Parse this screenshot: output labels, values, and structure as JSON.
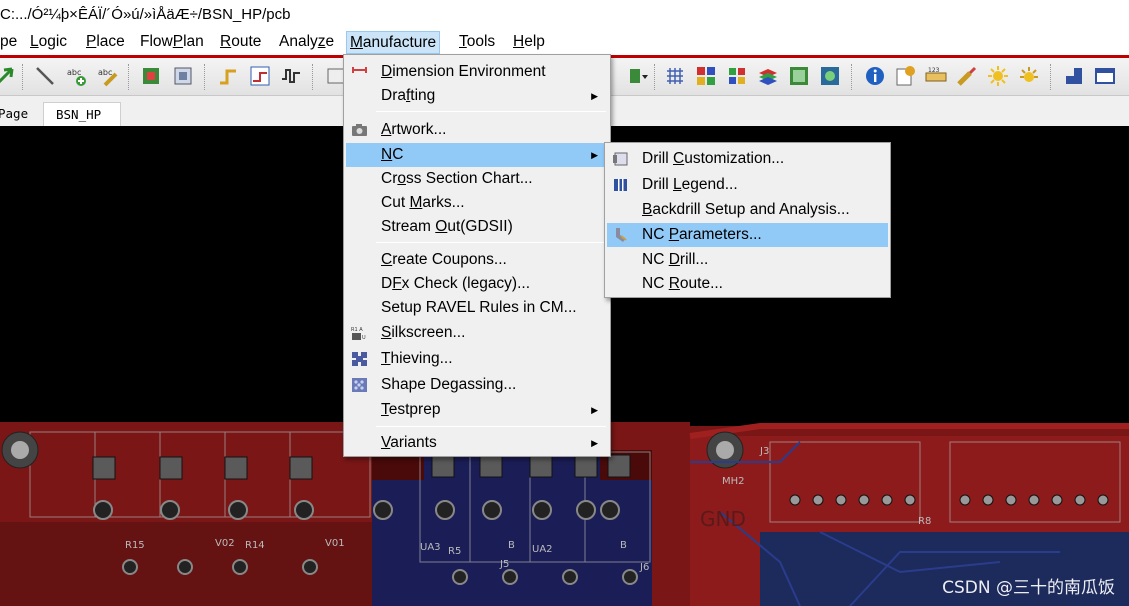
{
  "title": "C:.../Ó²¼þ×ÊÁÏ/´Ó»ú/»ìÅäÆ÷/BSN_HP/pcb",
  "menubar": {
    "items": [
      {
        "pre": "",
        "acc": "",
        "post": "pe"
      },
      {
        "pre": "",
        "acc": "L",
        "post": "ogic"
      },
      {
        "pre": "",
        "acc": "P",
        "post": "lace"
      },
      {
        "pre": "Flow",
        "acc": "P",
        "post": "lan"
      },
      {
        "pre": "",
        "acc": "R",
        "post": "oute"
      },
      {
        "pre": "Analy",
        "acc": "z",
        "post": "e"
      },
      {
        "pre": "",
        "acc": "M",
        "post": "anufacture"
      },
      {
        "pre": "",
        "acc": "T",
        "post": "ools"
      },
      {
        "pre": "",
        "acc": "H",
        "post": "elp"
      }
    ]
  },
  "tabs": [
    "Page",
    "BSN_HP"
  ],
  "manufacture_menu": {
    "items": [
      {
        "pre": "",
        "acc": "D",
        "post": "imension Environment",
        "icon": "dimension-icon",
        "submenu": false
      },
      {
        "pre": "Dra",
        "acc": "f",
        "post": "ting",
        "icon": "",
        "submenu": true
      },
      {
        "pre": "",
        "acc": "A",
        "post": "rtwork...",
        "icon": "camera-icon",
        "submenu": false
      },
      {
        "pre": "",
        "acc": "N",
        "post": "C",
        "icon": "",
        "submenu": true
      },
      {
        "pre": "Cr",
        "acc": "o",
        "post": "ss Section Chart...",
        "icon": "",
        "submenu": false
      },
      {
        "pre": "Cut ",
        "acc": "M",
        "post": "arks...",
        "icon": "",
        "submenu": false
      },
      {
        "pre": "Stream ",
        "acc": "O",
        "post": "ut(GDSII)",
        "icon": "",
        "submenu": false
      },
      {
        "pre": "",
        "acc": "C",
        "post": "reate Coupons...",
        "icon": "",
        "submenu": false
      },
      {
        "pre": "D",
        "acc": "F",
        "post": "x Check (legacy)...",
        "icon": "",
        "submenu": false
      },
      {
        "pre": "Setup RAVEL Rules in CM...",
        "acc": "",
        "post": "",
        "icon": "",
        "submenu": false
      },
      {
        "pre": "",
        "acc": "S",
        "post": "ilkscreen...",
        "icon": "silkscreen-icon",
        "submenu": false
      },
      {
        "pre": "",
        "acc": "T",
        "post": "hieving...",
        "icon": "thieving-icon",
        "submenu": false
      },
      {
        "pre": "Shape De",
        "acc": "g",
        "post": "assing...",
        "icon": "degassing-icon",
        "submenu": false
      },
      {
        "pre": "",
        "acc": "T",
        "post": "estprep",
        "icon": "",
        "submenu": true
      },
      {
        "pre": "",
        "acc": "V",
        "post": "ariants",
        "icon": "",
        "submenu": true
      }
    ]
  },
  "nc_submenu": {
    "items": [
      {
        "pre": "Drill ",
        "acc": "C",
        "post": "ustomization...",
        "icon": "drill-customization-icon"
      },
      {
        "pre": "Drill ",
        "acc": "L",
        "post": "egend...",
        "icon": "drill-legend-icon"
      },
      {
        "pre": "",
        "acc": "B",
        "post": "ackdrill Setup and Analysis...",
        "icon": ""
      },
      {
        "pre": "NC ",
        "acc": "P",
        "post": "arameters...",
        "icon": "nc-parameters-icon"
      },
      {
        "pre": "NC ",
        "acc": "D",
        "post": "rill...",
        "icon": ""
      },
      {
        "pre": "NC ",
        "acc": "R",
        "post": "oute...",
        "icon": ""
      }
    ]
  },
  "pcb_labels": {
    "gnd": "GND",
    "j3": "J3",
    "mh2": "MH2",
    "r15": "R15",
    "v02": "V02",
    "v01": "V01",
    "r14": "R14",
    "ua3": "UA3",
    "r5": "R5",
    "ua2": "UA2",
    "b1": "B",
    "b2": "B",
    "j5": "J5",
    "j6": "J6",
    "r8": "R8"
  },
  "watermark": "CSDN @三十的南瓜饭",
  "colors": {
    "menu_highlight": "#91c9f7",
    "active_menu": "#cce4f7",
    "pcb_red": "#8b1a1a",
    "pcb_blue": "#1a2a66"
  }
}
